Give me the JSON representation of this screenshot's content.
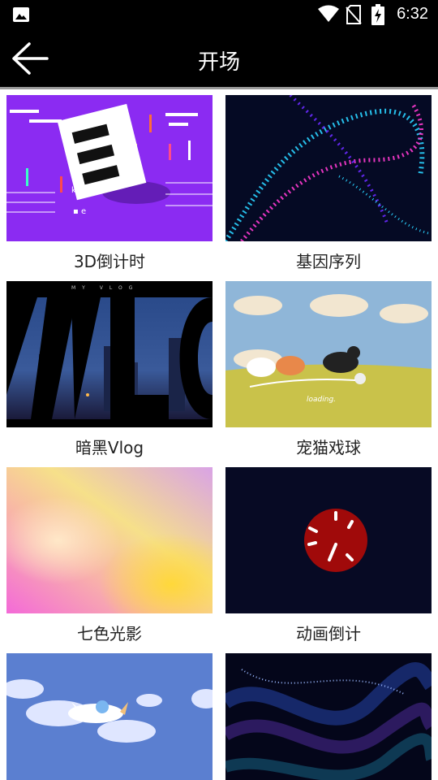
{
  "status_bar": {
    "time": "6:32",
    "icons": [
      "image-icon",
      "wifi-icon",
      "no-sim-icon",
      "battery-charging-icon"
    ]
  },
  "app_bar": {
    "back_icon": "back-arrow-icon",
    "title": "开场"
  },
  "templates": [
    {
      "label": "3D倒计时"
    },
    {
      "label": "基因序列"
    },
    {
      "label": "暗黑Vlog"
    },
    {
      "label": "宠猫戏球"
    },
    {
      "label": "七色光影"
    },
    {
      "label": "动画倒计"
    },
    {
      "label": ""
    },
    {
      "label": ""
    }
  ],
  "colors": {
    "bar_background": "#000000",
    "page_background": "#ffffff",
    "text": "#222222"
  }
}
